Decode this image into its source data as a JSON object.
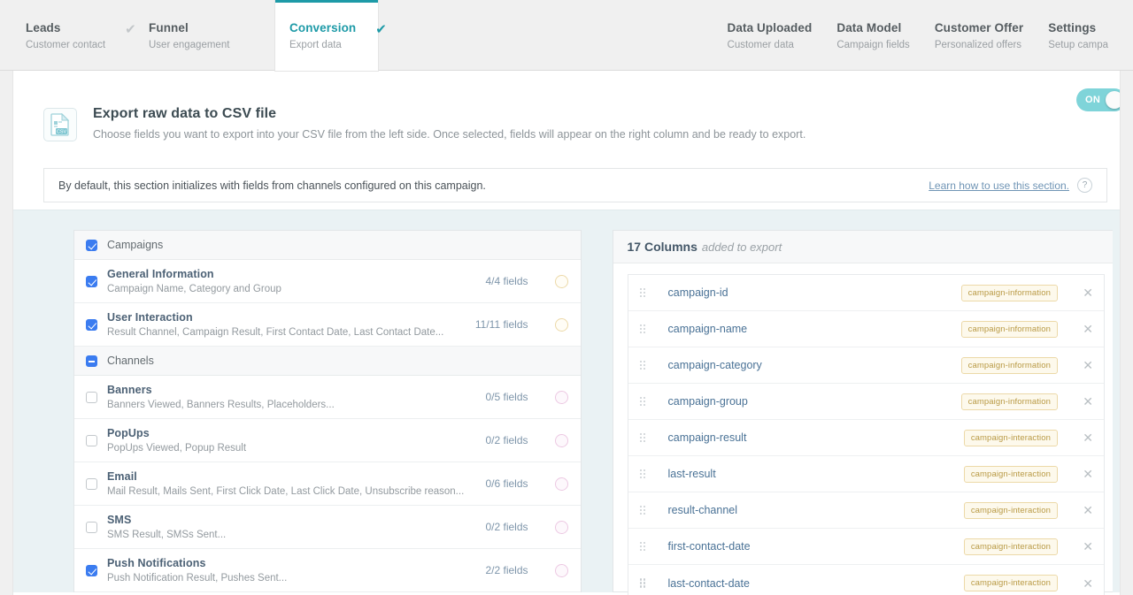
{
  "tabs_left": [
    {
      "title": "Leads",
      "sub": "Customer contact",
      "check": "✔",
      "active": false
    },
    {
      "title": "Funnel",
      "sub": "User engagement",
      "check": "",
      "active": false
    },
    {
      "title": "Conversion",
      "sub": "Export data",
      "check": "✔",
      "active": true
    }
  ],
  "tabs_right": [
    {
      "title": "Data Uploaded",
      "sub": "Customer data"
    },
    {
      "title": "Data Model",
      "sub": "Campaign fields"
    },
    {
      "title": "Customer Offer",
      "sub": "Personalized offers"
    },
    {
      "title": "Settings",
      "sub": "Setup campa"
    }
  ],
  "hero": {
    "icon": "csv-file-icon",
    "icon_label": "CSV",
    "title": "Export raw data to CSV file",
    "subtitle": "Choose fields you want to export into your CSV file from the left side. Once selected, fields will appear on the right column and be ready to export.",
    "toggle_label": "ON",
    "toggle_state": "on"
  },
  "notice": {
    "text": "By default, this section initializes with fields from channels configured on this campaign.",
    "link": "Learn how to use this section.",
    "help_icon": "?"
  },
  "left_panel": {
    "groups": [
      {
        "header": {
          "label": "Campaigns",
          "checkbox": "checked"
        },
        "rows": [
          {
            "title": "General Information",
            "sub": "Campaign Name, Category and Group",
            "count": "4/4 fields",
            "checkbox": "checked",
            "dot": "yellow"
          },
          {
            "title": "User Interaction",
            "sub": "Result Channel, Campaign Result, First Contact Date, Last Contact Date...",
            "count": "11/11 fields",
            "checkbox": "checked",
            "dot": "yellow"
          }
        ]
      },
      {
        "header": {
          "label": "Channels",
          "checkbox": "indeterminate"
        },
        "rows": [
          {
            "title": "Banners",
            "sub": "Banners Viewed, Banners Results, Placeholders...",
            "count": "0/5 fields",
            "checkbox": "unchecked",
            "dot": "pink"
          },
          {
            "title": "PopUps",
            "sub": "PopUps Viewed, Popup Result",
            "count": "0/2 fields",
            "checkbox": "unchecked",
            "dot": "pink"
          },
          {
            "title": "Email",
            "sub": "Mail Result, Mails Sent, First Click Date, Last Click Date, Unsubscribe reason...",
            "count": "0/6 fields",
            "checkbox": "unchecked",
            "dot": "pink"
          },
          {
            "title": "SMS",
            "sub": "SMS Result, SMSs Sent...",
            "count": "0/2 fields",
            "checkbox": "unchecked",
            "dot": "pink"
          },
          {
            "title": "Push Notifications",
            "sub": "Push Notification Result, Pushes Sent...",
            "count": "2/2 fields",
            "checkbox": "checked",
            "dot": "pink"
          }
        ]
      }
    ]
  },
  "right_panel": {
    "header_count": "17 Columns",
    "header_rest": "added to export",
    "remove_icon": "✕",
    "rows": [
      {
        "name": "campaign-id",
        "tag": "campaign-information"
      },
      {
        "name": "campaign-name",
        "tag": "campaign-information"
      },
      {
        "name": "campaign-category",
        "tag": "campaign-information"
      },
      {
        "name": "campaign-group",
        "tag": "campaign-information"
      },
      {
        "name": "campaign-result",
        "tag": "campaign-interaction"
      },
      {
        "name": "last-result",
        "tag": "campaign-interaction"
      },
      {
        "name": "result-channel",
        "tag": "campaign-interaction"
      },
      {
        "name": "first-contact-date",
        "tag": "campaign-interaction"
      },
      {
        "name": "last-contact-date",
        "tag": "campaign-interaction"
      }
    ]
  },
  "colors": {
    "accent_teal": "#1d9aa7",
    "checkbox_blue": "#3b7cf0",
    "tag_border": "#ecd9a8",
    "tag_text": "#b99a45",
    "link_blue": "#6f94b5",
    "panel_bg": "#eaf2f4"
  }
}
